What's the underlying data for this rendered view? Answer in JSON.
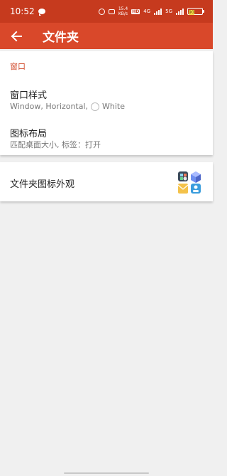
{
  "status_bar": {
    "time": "10:52",
    "speed_value": "15.4",
    "speed_unit": "KB/s",
    "hd": "HD",
    "net1": "4G",
    "net2": "5G",
    "battery": "90"
  },
  "app_bar": {
    "title": "文件夹"
  },
  "section": {
    "header": "窗口"
  },
  "prefs": [
    {
      "title": "窗口样式",
      "summary": "Window,  Horizontal,",
      "option": "White"
    },
    {
      "title": "图标布局",
      "summary": "匹配桌面大小, 标签：打开"
    }
  ],
  "appearance": {
    "title": "文件夹图标外观"
  }
}
